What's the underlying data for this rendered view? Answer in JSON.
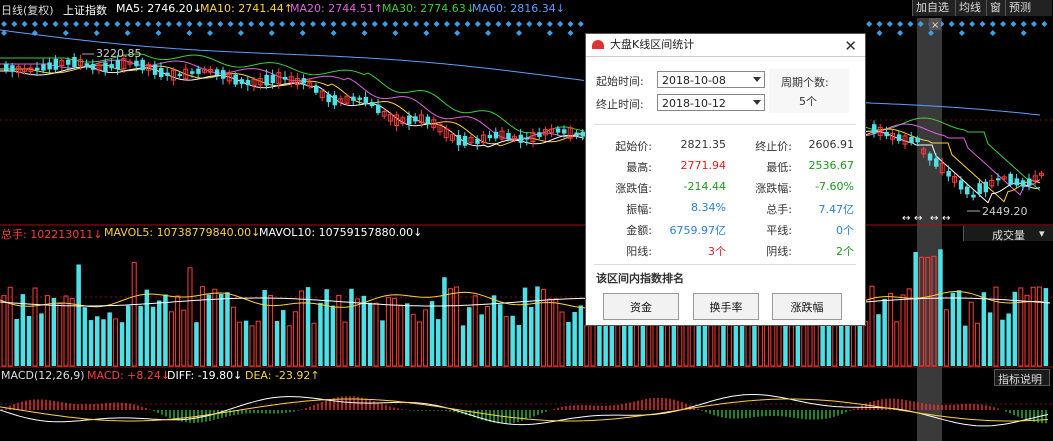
{
  "header": {
    "chart_name": "日线(复权)",
    "index_name": "上证指数",
    "ma5": "MA5: 2746.20↓",
    "ma10": "MA10: 2741.44↑",
    "ma20": "MA20: 2744.51↑",
    "ma30": "MA30: 2774.63↓",
    "ma60": "MA60: 2816.34↓"
  },
  "toolbar": {
    "add_watch": "加自选",
    "ma_line": "均线",
    "window": "窗",
    "forecast": "预测"
  },
  "price_labels": {
    "high_marker": "3220.85",
    "low_marker": "2449.20"
  },
  "volume": {
    "total_hands": "总手: 102213011↓",
    "mavol5": "MAVOL5: 10738779840.00↓",
    "mavol10": "MAVOL10: 10759157880.00↓",
    "indicator_select": "成交量"
  },
  "macd": {
    "params": "MACD(12,26,9)",
    "macd_value": "MACD: +8.24↓",
    "diff": "DIFF: -19.80↓",
    "dea": "DEA: -23.92↑",
    "help": "指标说明"
  },
  "dialog": {
    "title": "大盘K线区间统计",
    "start_label": "起始时间:",
    "start_value": "2018-10-08",
    "end_label": "终止时间:",
    "end_value": "2018-10-12",
    "count_label": "周期个数:",
    "count_value": "5个",
    "stats": {
      "open_label": "起始价:",
      "open_value": "2821.35",
      "close_label": "终止价:",
      "close_value": "2606.91",
      "high_label": "最高:",
      "high_value": "2771.94",
      "low_label": "最低:",
      "low_value": "2536.67",
      "change_label": "涨跌值:",
      "change_value": "-214.44",
      "change_pct_label": "涨跌幅:",
      "change_pct_value": "-7.60%",
      "amplitude_label": "振幅:",
      "amplitude_value": "8.34%",
      "volume_label": "总手:",
      "volume_value": "7.47亿",
      "amount_label": "金额:",
      "amount_value": "6759.97亿",
      "flat_label": "平线:",
      "flat_value": "0个",
      "up_label": "阳线:",
      "up_value": "3个",
      "down_label": "阴线:",
      "down_value": "2个"
    },
    "ranking_title": "该区间内指数排名",
    "buttons": {
      "funds": "资金",
      "turnover": "换手率",
      "change_pct": "涨跌幅"
    }
  },
  "colors": {
    "up": "#ff3b3b",
    "down": "#4fe0e6",
    "ma5": "#ffffff",
    "ma10": "#ffd23a",
    "ma20": "#e060e0",
    "ma30": "#37d03a",
    "ma60": "#5aa0ff"
  }
}
